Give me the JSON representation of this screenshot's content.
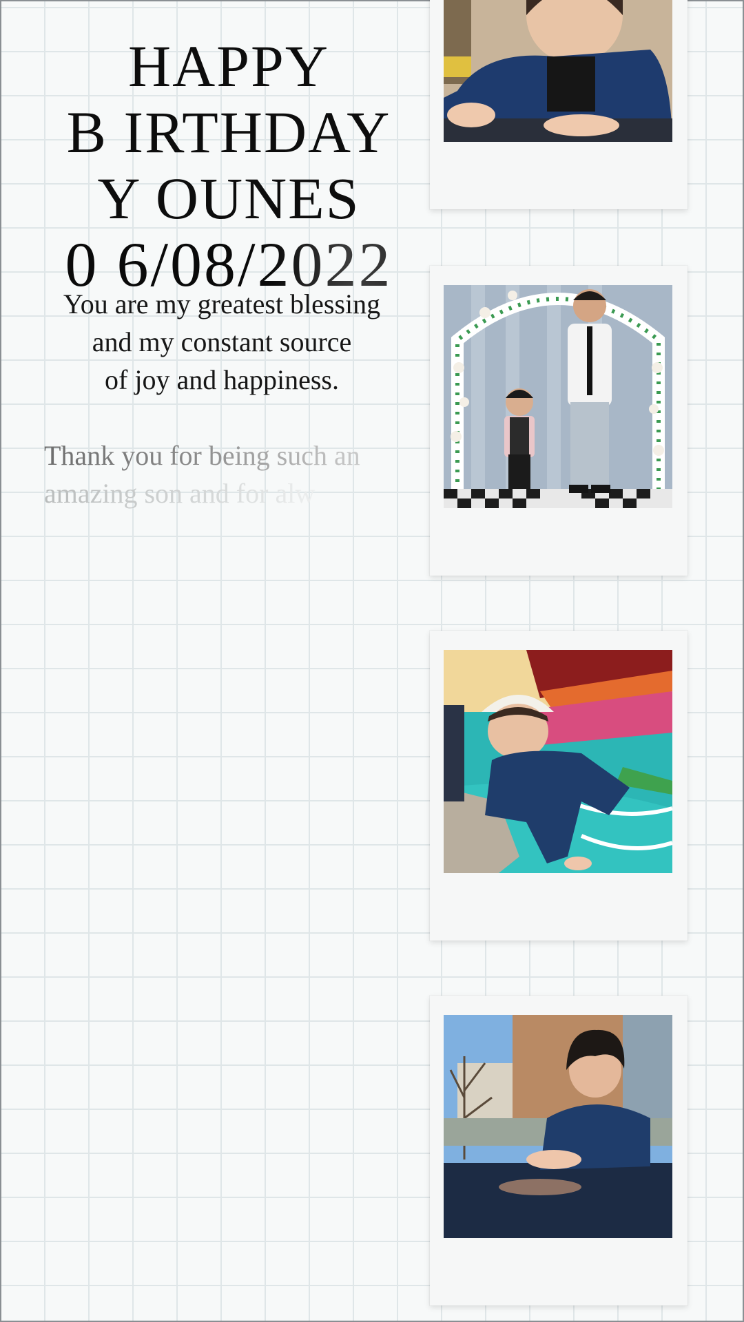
{
  "title": {
    "line1": "HAPPY",
    "line2": "B IRTHDAY",
    "line3": "Y OUNES",
    "date": "0 6/08/2022"
  },
  "message": {
    "lines": [
      "You are my greatest blessing",
      "and my constant source",
      "of joy and happiness."
    ],
    "fading_lines": [
      "Thank you for being such an",
      "amazing son and for alw"
    ]
  },
  "photos": [
    {
      "subject": "boy-at-table-closeup-photo"
    },
    {
      "subject": "figurine-father-and-son-under-flower-arch-photo"
    },
    {
      "subject": "boy-in-white-cap-on-prayer-rug-photo"
    },
    {
      "subject": "boy-leaning-on-table-outdoors-photo"
    }
  ],
  "colors": {
    "background": "#f7f9f9",
    "grid_lines": "#dfe6e8",
    "text": "#0d0d0d",
    "polaroid_frame": "#f6f7f7"
  }
}
